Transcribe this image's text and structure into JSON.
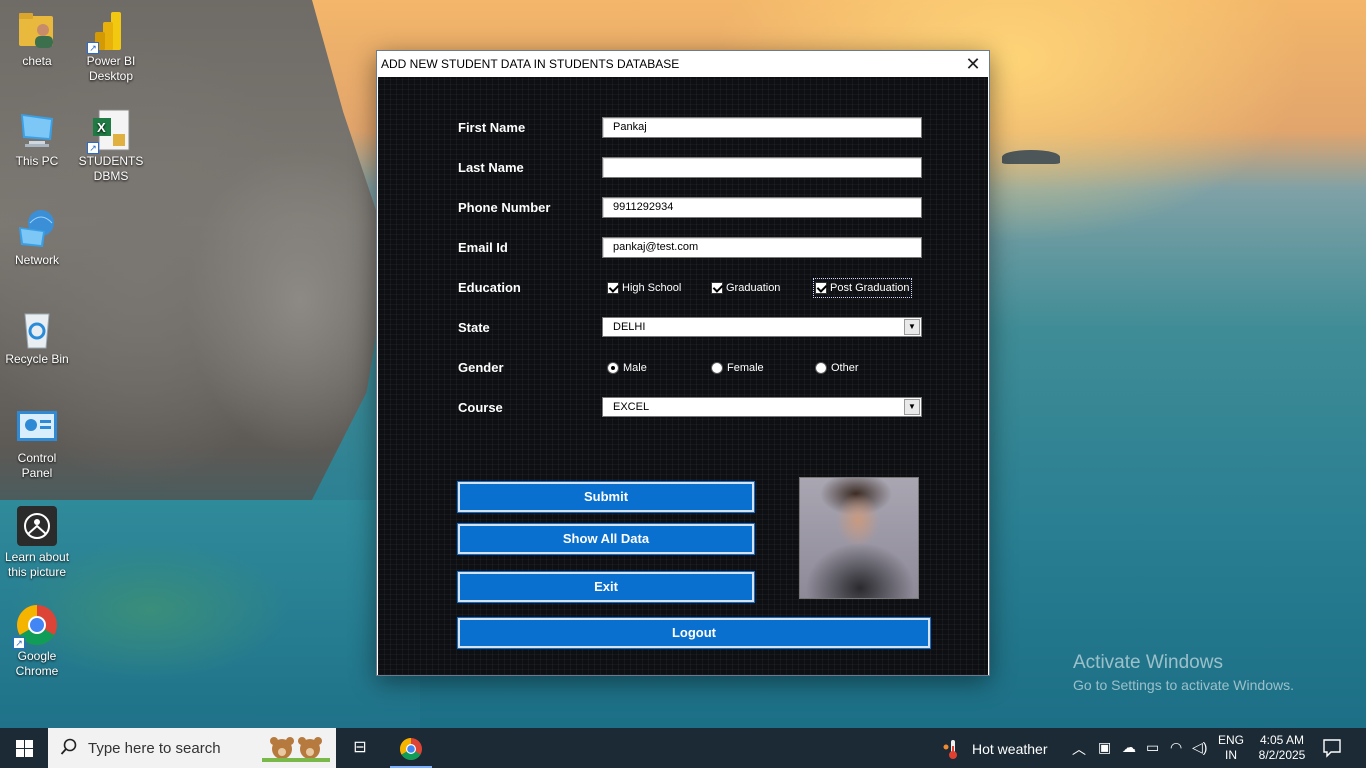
{
  "desktop": {
    "icons": [
      {
        "label_line1": "cheta",
        "label_line2": "",
        "icon": "user-folder-icon"
      },
      {
        "label_line1": "Power BI",
        "label_line2": "Desktop",
        "icon": "power-bi-icon"
      },
      {
        "label_line1": "This PC",
        "label_line2": "",
        "icon": "computer-icon"
      },
      {
        "label_line1": "STUDENTS",
        "label_line2": "DBMS",
        "icon": "excel-icon"
      },
      {
        "label_line1": "Network",
        "label_line2": "",
        "icon": "network-icon"
      },
      {
        "label_line1": "Recycle Bin",
        "label_line2": "",
        "icon": "recycle-bin-icon"
      },
      {
        "label_line1": "Control",
        "label_line2": "Panel",
        "icon": "control-panel-icon"
      },
      {
        "label_line1": "Learn about",
        "label_line2": "this picture",
        "icon": "camera-icon"
      },
      {
        "label_line1": "Google",
        "label_line2": "Chrome",
        "icon": "chrome-icon"
      }
    ]
  },
  "dialog": {
    "title": "ADD NEW STUDENT  DATA IN STUDENTS DATABASE",
    "close_glyph": "✕",
    "fields": {
      "first_name": {
        "label": "First Name",
        "value": "Pankaj"
      },
      "last_name": {
        "label": "Last Name",
        "value": ""
      },
      "phone": {
        "label": "Phone Number",
        "value": "9911292934"
      },
      "email": {
        "label": "Email Id",
        "value": "pankaj@test.com"
      }
    },
    "education": {
      "label": "Education",
      "options": [
        {
          "label": "High School",
          "checked": true
        },
        {
          "label": "Graduation",
          "checked": true
        },
        {
          "label": "Post Graduation",
          "checked": true
        }
      ]
    },
    "state": {
      "label": "State",
      "value": "DELHI"
    },
    "gender": {
      "label": "Gender",
      "options": [
        {
          "label": "Male",
          "selected": true
        },
        {
          "label": "Female",
          "selected": false
        },
        {
          "label": "Other",
          "selected": false
        }
      ]
    },
    "course": {
      "label": "Course",
      "value": "EXCEL"
    },
    "buttons": {
      "submit": "Submit",
      "show_all": "Show All Data",
      "exit": "Exit",
      "logout": "Logout"
    }
  },
  "watermark": {
    "line1": "Activate Windows",
    "line2": "Go to Settings to activate Windows."
  },
  "taskbar": {
    "search_placeholder": "Type here to search",
    "weather": "Hot weather",
    "language_line1": "ENG",
    "language_line2": "IN",
    "time": "4:05 AM",
    "date": "8/2/2025"
  },
  "colors": {
    "button_blue": "#0a70d0",
    "dialog_background": "#0d0f12",
    "taskbar": "#1b2a35"
  }
}
